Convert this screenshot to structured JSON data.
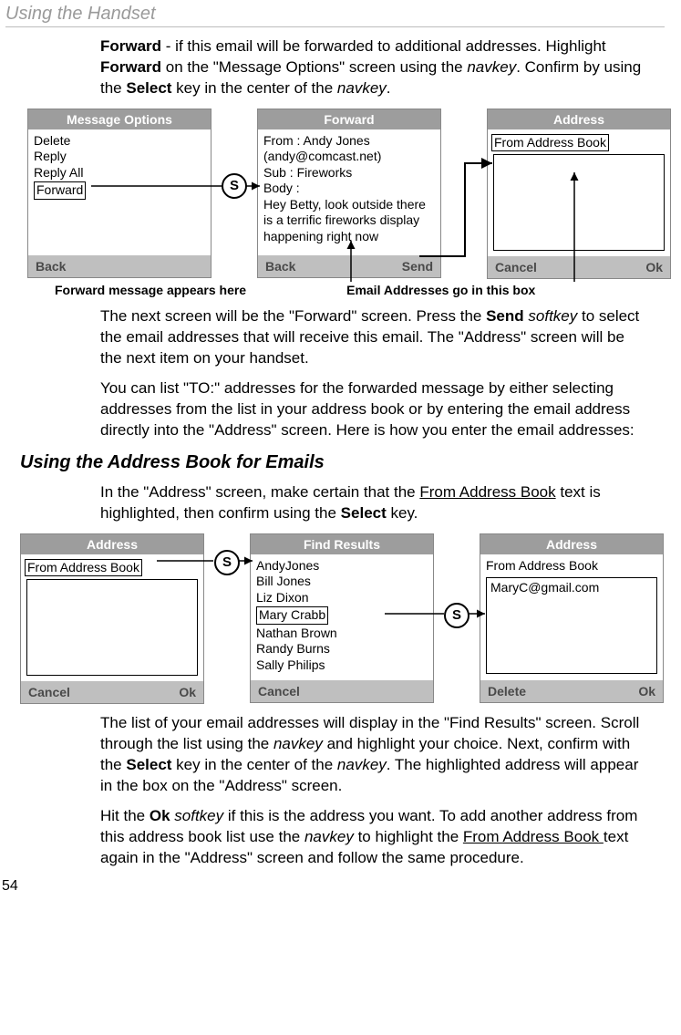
{
  "header": "Using the Handset",
  "page_number": "54",
  "para1_pre": "Forward",
  "para1_mid1": " - if this email will be forwarded to additional addresses. Highlight ",
  "para1_bold2": "Forward",
  "para1_mid2": " on the \"Message Options\" screen using the ",
  "para1_em1": "navkey",
  "para1_mid3": ". Confirm by using the ",
  "para1_bold3": "Select",
  "para1_mid4": " key in the center of the ",
  "para1_em2": "navkey",
  "para1_end": ".",
  "row1": {
    "s1": {
      "title": "Message Options",
      "items": [
        "Delete",
        "Reply",
        "Reply All",
        "Forward"
      ],
      "left": "Back",
      "right": ""
    },
    "s2": {
      "title": "Forward",
      "from": "From : Andy Jones (andy@comcast.net)",
      "sub": "Sub :  Fireworks",
      "bodylabel": "Body :",
      "body": "Hey Betty, look outside there is a terrific fireworks display happening right now",
      "left": "Back",
      "right": "Send"
    },
    "s3": {
      "title": "Address",
      "opt": "From Address Book",
      "left": "Cancel",
      "right": "Ok"
    },
    "cap1": "Forward message appears here",
    "cap2": "Email Addresses go in this box"
  },
  "para2_a": "The next screen will be the \"Forward\" screen. Press the ",
  "para2_b": "Send",
  "para2_c": " ",
  "para2_d": "softkey",
  "para2_e": " to select the email addresses that will receive this email. The \"Address\" screen will be the next item on your handset.",
  "para3": "You can list \"TO:\" addresses for the forwarded message by either selecting addresses from the list in your address book or by entering the email address directly into the \"Address\" screen. Here is how you enter the email addresses:",
  "heading2": "Using the Address Book for Emails",
  "para4_a": "In the \"Address\" screen, make certain that the ",
  "para4_u": "From Address Book",
  "para4_b": " text is highlighted, then confirm using the ",
  "para4_c": "Select",
  "para4_d": " key.",
  "row2": {
    "s1": {
      "title": "Address",
      "opt": "From Address Book",
      "left": "Cancel",
      "right": "Ok"
    },
    "s2": {
      "title": "Find Results",
      "items": [
        "AndyJones",
        "Bill Jones",
        "Liz Dixon",
        "Mary Crabb",
        "Nathan Brown",
        "Randy Burns",
        "Sally Philips"
      ],
      "left": "Cancel",
      "right": ""
    },
    "s3": {
      "title": "Address",
      "opt": "From Address Book",
      "value": "MaryC@gmail.com",
      "left": "Delete",
      "right": "Ok"
    }
  },
  "para5_a": "The list of your email addresses will display in the \"Find Results\" screen. Scroll through the list using the ",
  "para5_em1": "navkey",
  "para5_b": " and highlight your choice. Next, confirm with the ",
  "para5_bold": "Select",
  "para5_c": " key in the center of the ",
  "para5_em2": "navkey",
  "para5_d": ". The highlighted address will appear in the box on the \"Address\" screen.",
  "para6_a": "Hit the ",
  "para6_b": "Ok",
  "para6_c": " ",
  "para6_em1": "softkey",
  "para6_d": " if this is the address you want. To add another address from this address book list use the ",
  "para6_em2": "navkey",
  "para6_e": " to highlight the ",
  "para6_u": "From Address Book ",
  "para6_f": "text again in the \"Address\" screen and follow the same procedure."
}
